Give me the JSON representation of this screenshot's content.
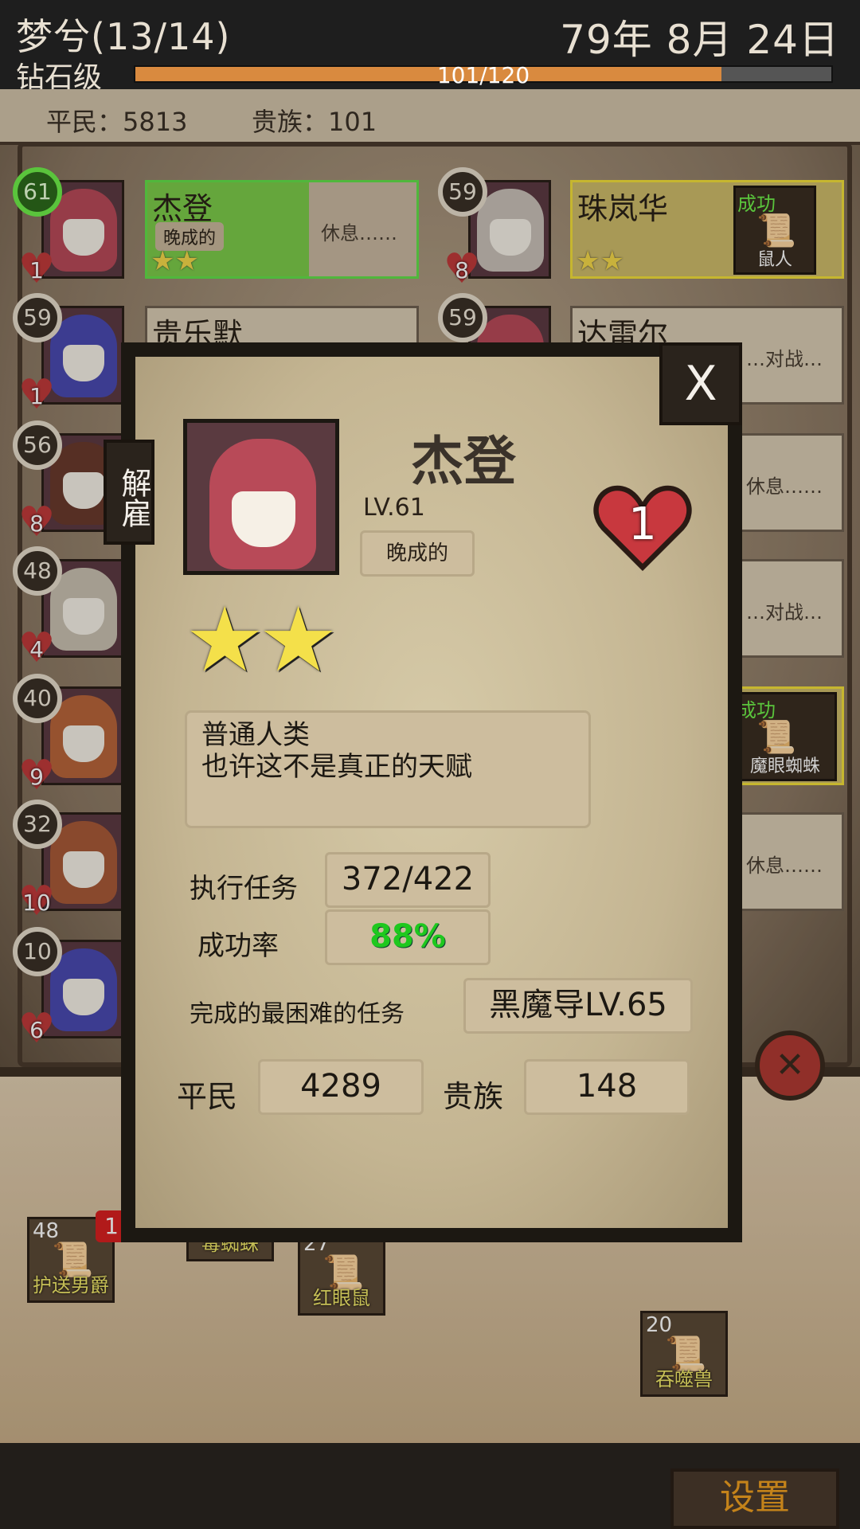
{
  "header": {
    "guild_name": "梦兮(13/14)",
    "date": "79年 8月 24日",
    "rank": "钻石级",
    "exp_text": "101/120",
    "exp_fraction": 0.842
  },
  "population": {
    "commoners": "平民：5813",
    "nobles": "贵族：101"
  },
  "adventurers_left": [
    {
      "level": "61",
      "hearts": "1",
      "name": "杰登",
      "trait": "晚成的",
      "status": "休息……",
      "stars": "★★",
      "hair": "#b84a58",
      "selected": true
    },
    {
      "level": "59",
      "hearts": "1",
      "name": "贵乐默",
      "status": "",
      "hair": "#4a4ab0"
    },
    {
      "level": "56",
      "hearts": "8",
      "hair": "#6a3a2c"
    },
    {
      "level": "48",
      "hearts": "4",
      "hair": "#c8c0b0"
    },
    {
      "level": "40",
      "hearts": "9",
      "hair": "#b8643a"
    },
    {
      "level": "32",
      "hearts": "10",
      "hair": "#a85a38"
    },
    {
      "level": "10",
      "hearts": "6",
      "hair": "#4a4ab0"
    }
  ],
  "adventurers_right": [
    {
      "level": "59",
      "hearts": "8",
      "name": "珠岚华",
      "stars": "★★",
      "mission_result": "成功",
      "mission": "鼠人",
      "hair": "#c8c0b8"
    },
    {
      "level": "59",
      "name": "达雷尔",
      "status": "…对战…",
      "hair": "#b84a58"
    },
    {
      "status": "休息……"
    },
    {
      "status": "…对战…"
    },
    {
      "mission_result": "成功",
      "mission": "魔眼蜘蛛"
    },
    {
      "status": "休息……"
    }
  ],
  "quests": [
    {
      "level": "48",
      "name": "护送男爵"
    },
    {
      "name": "毒蜘蛛"
    },
    {
      "level": "27",
      "name": "红眼鼠"
    },
    {
      "level": "20",
      "name": "吞噬兽"
    }
  ],
  "quest_alert": "1",
  "settings_label": "设置",
  "cancel_icon": "✕",
  "dialog": {
    "close_label": "X",
    "dismiss_label": "解雇",
    "name": "杰登",
    "level": "LV.61",
    "trait": "晚成的",
    "hearts": "1",
    "stars": "★★",
    "description_lines": [
      "普通人类",
      "也许这不是真正的天赋"
    ],
    "missions_label": "执行任务",
    "missions_value": "372/422",
    "success_rate_label": "成功率",
    "success_rate_value": "88%",
    "hardest_label": "完成的最困难的任务",
    "hardest_value": "黑魔导LV.65",
    "commoners_label": "平民",
    "commoners_value": "4289",
    "nobles_label": "贵族",
    "nobles_value": "148"
  },
  "colors": {
    "exp_fill": "#d98a3f",
    "success_green": "#1ec81e",
    "selected_border": "#62e04a",
    "mission_border": "#f2df3a",
    "settings_text": "#f0a020"
  }
}
